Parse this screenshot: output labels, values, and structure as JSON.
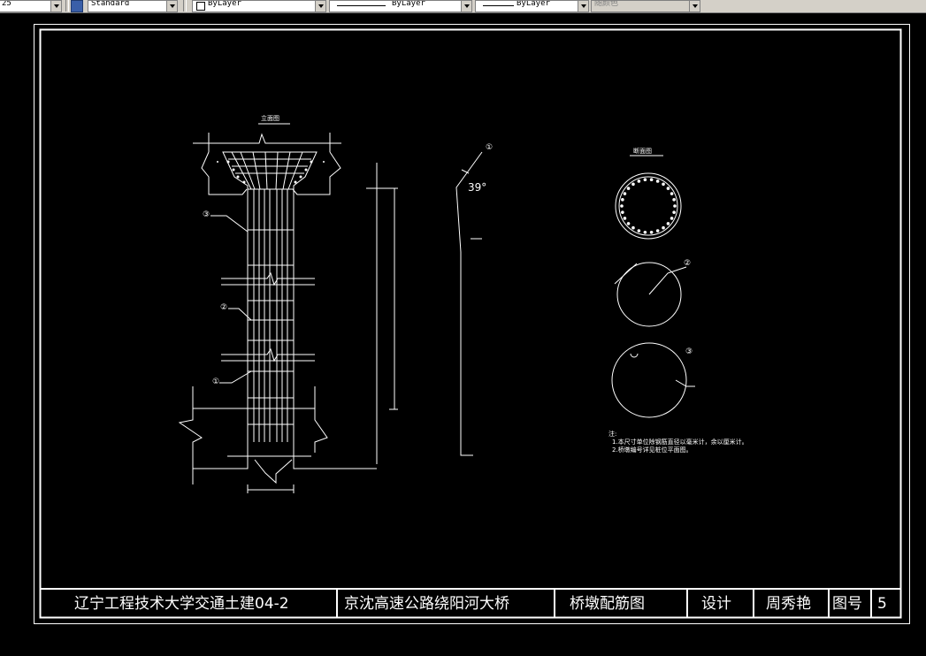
{
  "toolbar": {
    "scale_value": "25",
    "text_style": "Standard",
    "layer": "ByLayer",
    "linetype": "ByLayer",
    "lineweight": "ByLayer",
    "plot_style": "随颜色"
  },
  "drawing": {
    "elevation_view_title": "立面图",
    "section_view_title": "断面图",
    "angle_label": "39°",
    "marker_1": "①",
    "marker_2": "②",
    "marker_3": "③",
    "notes_heading": "注:",
    "note_1": "1.本尺寸单位除钢筋直径以毫米计，余以厘米计。",
    "note_2": "2.桥墩编号详见桩位平面图。"
  },
  "title_block": {
    "school": "辽宁工程技术大学交通土建04-2",
    "project": "京沈高速公路绕阳河大桥",
    "drawing_name": "桥墩配筋图",
    "design_label": "设计",
    "designer": "周秀艳",
    "sheet_label": "图号",
    "sheet_number": "5"
  }
}
